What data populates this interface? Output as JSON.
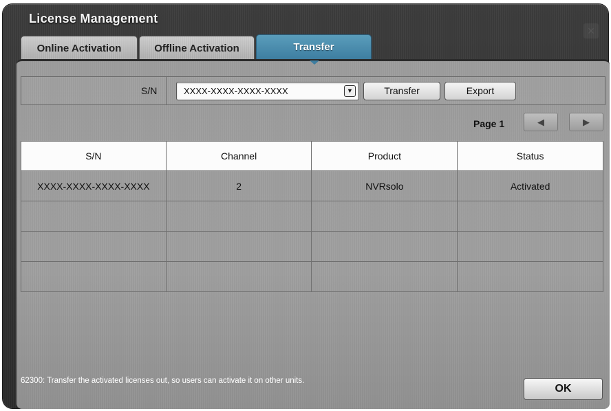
{
  "window": {
    "title": "License Management",
    "close_glyph": "×"
  },
  "tabs": [
    {
      "label": "Online Activation",
      "active": false
    },
    {
      "label": "Offline Activation",
      "active": false
    },
    {
      "label": "Transfer",
      "active": true
    }
  ],
  "serial": {
    "label": "S/N",
    "selected": "XXXX-XXXX-XXXX-XXXX",
    "dropdown_glyph": "▼",
    "transfer_label": "Transfer",
    "export_label": "Export"
  },
  "pagination": {
    "label": "Page 1",
    "prev_glyph": "◀",
    "next_glyph": "▶"
  },
  "table": {
    "headers": [
      "S/N",
      "Channel",
      "Product",
      "Status"
    ],
    "rows": [
      [
        "XXXX-XXXX-XXXX-XXXX",
        "2",
        "NVRsolo",
        "Activated"
      ],
      [
        "",
        "",
        "",
        ""
      ],
      [
        "",
        "",
        "",
        ""
      ],
      [
        "",
        "",
        "",
        ""
      ]
    ]
  },
  "footer": {
    "message": "62300: Transfer the activated licenses out, so users can activate it on other units.",
    "ok_label": "OK"
  },
  "colors": {
    "active_tab": "#3d7da0",
    "panel": "#9a9a9a",
    "window": "#333333"
  }
}
